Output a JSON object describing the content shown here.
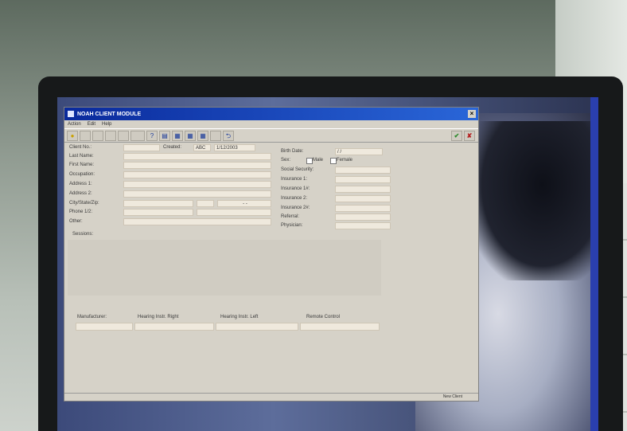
{
  "window": {
    "title": "NOAH CLIENT MODULE",
    "menu": [
      "Action",
      "Edit",
      "Help"
    ]
  },
  "toolbar": {
    "help_glyph": "?",
    "undo_glyph": "⮌",
    "check_glyph": "✔",
    "close_glyph": "✘"
  },
  "form": {
    "labels": {
      "client_no": "Client No.:",
      "last_name": "Last Name:",
      "first_name": "First Name:",
      "occupation": "Occupation:",
      "address1": "Address 1:",
      "address2": "Address 2:",
      "city_state_zip": "City/State/Zip:",
      "phone": "Phone 1/2:",
      "other": "Other:",
      "sessions": "Sessions:",
      "created": "Created:",
      "birth_date": "Birth Date:",
      "sex": "Sex:",
      "male": "Male",
      "female": "Female",
      "social_security": "Social Security:",
      "insurance1": "Insurance 1:",
      "insurance1b": "Insurance 1#:",
      "insurance2": "Insurance 2:",
      "insurance2b": "Insurance 2#:",
      "referral": "Referral:",
      "physician": "Physician:"
    },
    "values": {
      "created_by": "ABC",
      "created_date": "1/12/2003",
      "birth_date": "/ /",
      "zip_mask": "- -"
    }
  },
  "grid": {
    "headers": [
      "Manufacturer:",
      "Hearing Instr. Right",
      "Hearing Instr. Left",
      "Remote Control"
    ]
  },
  "status": {
    "text": "New Client"
  }
}
